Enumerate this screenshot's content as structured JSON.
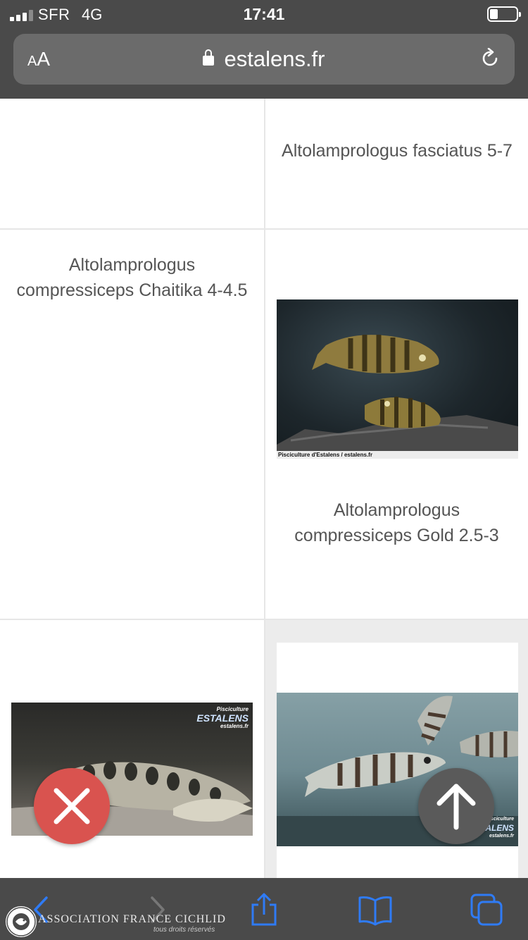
{
  "status_bar": {
    "carrier": "SFR",
    "network": "4G",
    "time": "17:41",
    "signal_bars": 4,
    "signal_bars_active": 3,
    "battery_level": 0.25
  },
  "address_bar": {
    "text_size_label_small": "A",
    "text_size_label_large": "A",
    "domain": "estalens.fr",
    "lock_icon": "lock-icon",
    "reload_icon": "reload-icon"
  },
  "products": [
    {
      "title": "Altolamprologus fasciatus 5-7"
    },
    {
      "title": "Altolamprologus compressiceps Chaitika 4-4.5"
    },
    {
      "title": "Altolamprologus compressiceps Gold 2.5-3",
      "image_caption": "Pisciculture d'Estalens / estalens.fr"
    },
    {
      "image_logo_line1": "Pisciculture",
      "image_logo_line2": "ESTALENS",
      "image_logo_line3": "estalens.fr"
    },
    {
      "image_logo_line1": "Pisciculture",
      "image_logo_line2": "ESTALENS",
      "image_logo_line3": "estalens.fr"
    }
  ],
  "floating_buttons": {
    "close_icon": "close-icon",
    "scroll_top_icon": "arrow-up-icon"
  },
  "toolbar": {
    "icons": [
      "back-icon",
      "forward-icon",
      "share-icon",
      "bookmarks-icon",
      "tabs-icon"
    ]
  },
  "watermark": {
    "name": "ASSOCIATION FRANCE CICHLID",
    "rights": "tous droits réservés",
    "seal_text": "ASSOCIATION FRANCE CICHLID"
  },
  "colors": {
    "chrome_bg": "#4a4a4a",
    "url_field_bg": "#6b6b6b",
    "close_button": "#d9534f",
    "scroll_top_button": "#5a5a5a",
    "toolbar_icon_active": "#2f7bf5"
  }
}
